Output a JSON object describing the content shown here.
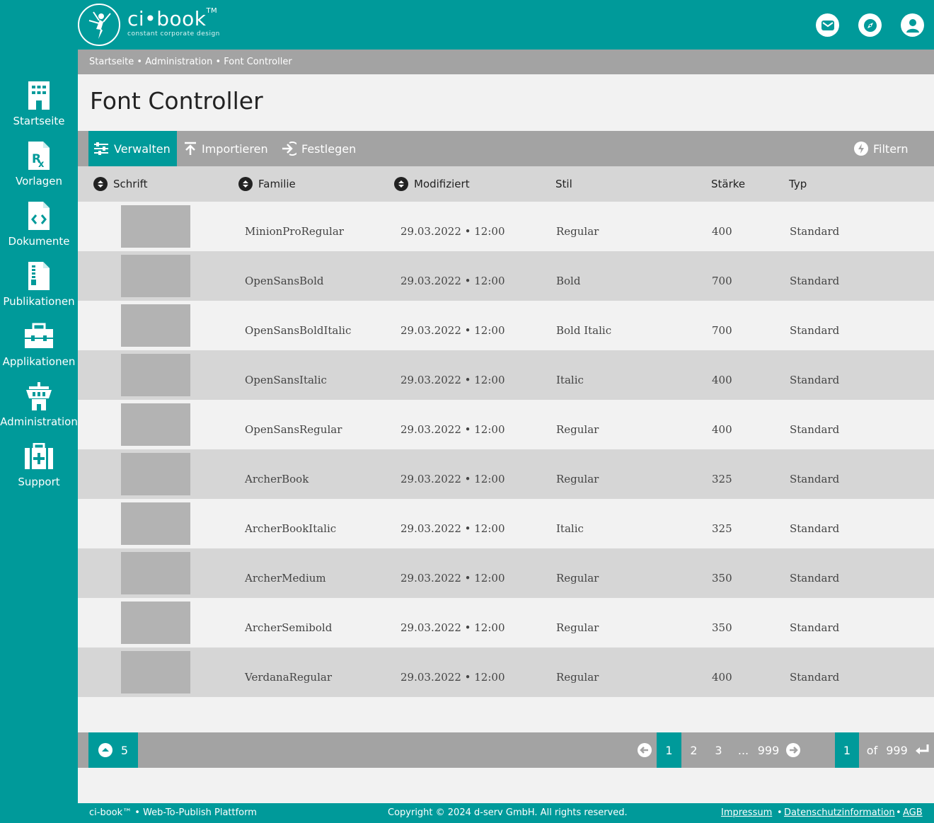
{
  "brand": {
    "name": "ci•book",
    "tm": "TM",
    "tagline": "constant corporate design"
  },
  "sidebar": {
    "items": [
      {
        "label": "Startseite",
        "icon": "building-icon"
      },
      {
        "label": "Vorlagen",
        "icon": "template-rx-icon"
      },
      {
        "label": "Dokumente",
        "icon": "code-file-icon"
      },
      {
        "label": "Publikationen",
        "icon": "publication-file-icon"
      },
      {
        "label": "Applikationen",
        "icon": "toolbox-icon"
      },
      {
        "label": "Administration",
        "icon": "tower-icon"
      },
      {
        "label": "Support",
        "icon": "first-aid-icon"
      }
    ]
  },
  "header": {
    "icons": [
      "mail-icon",
      "compass-icon",
      "user-icon"
    ]
  },
  "breadcrumb": {
    "items": [
      "Startseite",
      "Administration",
      "Font Controller"
    ],
    "separator": "•"
  },
  "page": {
    "title": "Font Controller"
  },
  "toolbar": {
    "manage": "Verwalten",
    "import": "Importieren",
    "define": "Festlegen",
    "filter": "Filtern"
  },
  "columns": {
    "font": "Schrift",
    "family": "Familie",
    "modified": "Modifiziert",
    "style": "Stil",
    "weight": "Stärke",
    "type": "Typ"
  },
  "rows": [
    {
      "family": "MinionProRegular",
      "modified": "29.03.2022 • 12:00",
      "style": "Regular",
      "weight": "400",
      "type": "Standard"
    },
    {
      "family": "OpenSansBold",
      "modified": "29.03.2022 • 12:00",
      "style": "Bold",
      "weight": "700",
      "type": "Standard"
    },
    {
      "family": "OpenSansBoldItalic",
      "modified": "29.03.2022 • 12:00",
      "style": "Bold Italic",
      "weight": "700",
      "type": "Standard"
    },
    {
      "family": "OpenSansItalic",
      "modified": "29.03.2022 • 12:00",
      "style": "Italic",
      "weight": "400",
      "type": "Standard"
    },
    {
      "family": "OpenSansRegular",
      "modified": "29.03.2022 • 12:00",
      "style": "Regular",
      "weight": "400",
      "type": "Standard"
    },
    {
      "family": "ArcherBook",
      "modified": "29.03.2022 • 12:00",
      "style": "Regular",
      "weight": "325",
      "type": "Standard"
    },
    {
      "family": "ArcherBookItalic",
      "modified": "29.03.2022 • 12:00",
      "style": "Italic",
      "weight": "325",
      "type": "Standard"
    },
    {
      "family": "ArcherMedium",
      "modified": "29.03.2022 • 12:00",
      "style": "Regular",
      "weight": "350",
      "type": "Standard"
    },
    {
      "family": "ArcherSemibold",
      "modified": "29.03.2022 • 12:00",
      "style": "Regular",
      "weight": "350",
      "type": "Standard"
    },
    {
      "family": "VerdanaRegular",
      "modified": "29.03.2022 • 12:00",
      "style": "Regular",
      "weight": "400",
      "type": "Standard"
    }
  ],
  "pagination": {
    "page_size": "5",
    "pages": [
      "1",
      "2",
      "3"
    ],
    "ellipsis": "...",
    "last": "999",
    "current": "1",
    "of_label": "of",
    "total": "999"
  },
  "footer": {
    "left": "ci-book™ • Web-To-Publish Plattform",
    "copyright": "Copyright © 2024 d-serv GmbH. All rights reserved.",
    "impressum": "Impressum",
    "privacy": "Datenschutzinformation",
    "agb": "AGB",
    "sep": "•"
  },
  "colors": {
    "teal": "#009a9a",
    "gray": "#a3a3a3",
    "light_gray": "#d6d6d6",
    "background": "#f2f2f2"
  }
}
